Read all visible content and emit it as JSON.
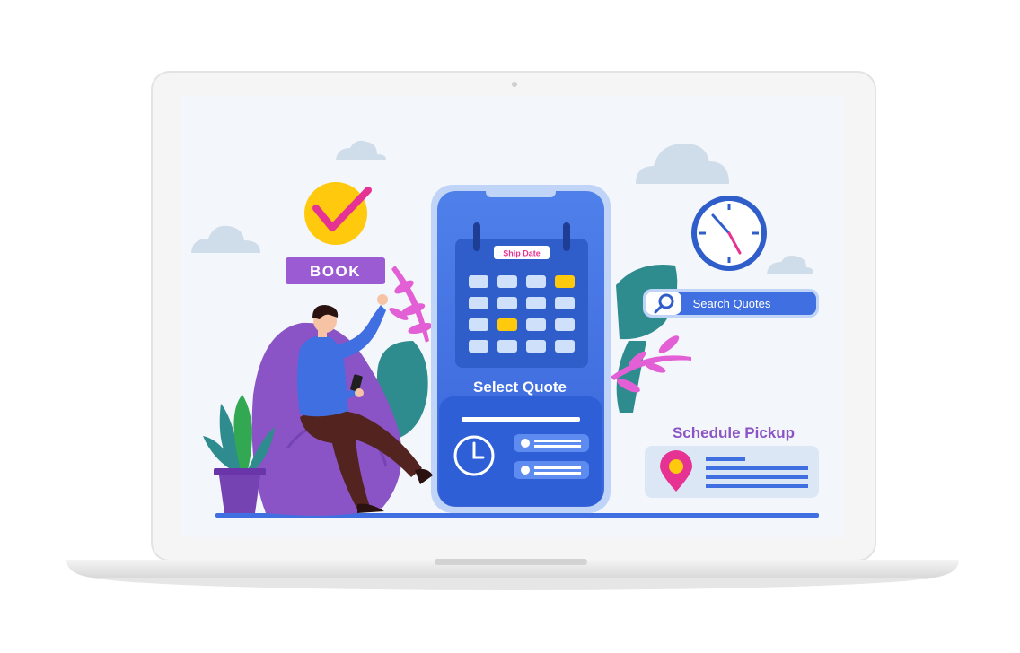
{
  "book_badge": {
    "label": "BOOK"
  },
  "phone": {
    "calendar_tag": "Ship Date",
    "title": "Select Quote"
  },
  "search": {
    "label": "Search Quotes"
  },
  "pickup": {
    "title": "Schedule Pickup"
  },
  "colors": {
    "primary_blue": "#3F6FE0",
    "purple": "#8B54C6",
    "yellow": "#FFC90E",
    "magenta": "#E63393",
    "sky": "#F3F6FA"
  },
  "icons": [
    "check-icon",
    "calendar-icon",
    "clock-icon",
    "search-icon",
    "location-pin-icon",
    "cloud-icon",
    "plant-icon"
  ]
}
